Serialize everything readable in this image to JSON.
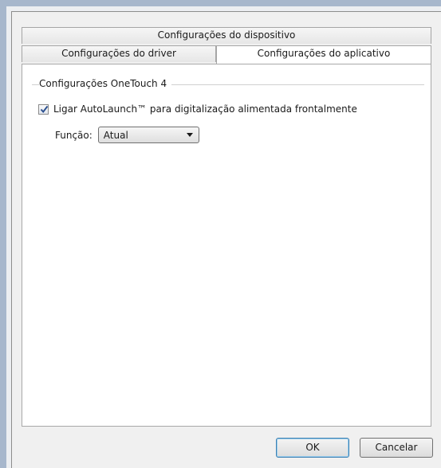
{
  "tabs": {
    "row_top": [
      {
        "label": "Configurações do dispositivo"
      }
    ],
    "row_bottom": [
      {
        "label": "Configurações do driver"
      },
      {
        "label": "Configurações do aplicativo"
      }
    ],
    "active": "Configurações do aplicativo"
  },
  "panel": {
    "group_title": "Configurações OneTouch 4",
    "autolaunch": {
      "label": "Ligar AutoLaunch™ para digitalização alimentada frontalmente",
      "checked": true
    },
    "function": {
      "label": "Função:",
      "selected": "Atual"
    }
  },
  "buttons": {
    "ok": "OK",
    "cancel": "Cancelar"
  },
  "colors": {
    "frame": "#a7b7cc",
    "dialog_bg": "#f0f0f0",
    "panel_bg": "#ffffff"
  },
  "icons": [
    "checkmark-icon",
    "dropdown-arrow-icon"
  ]
}
